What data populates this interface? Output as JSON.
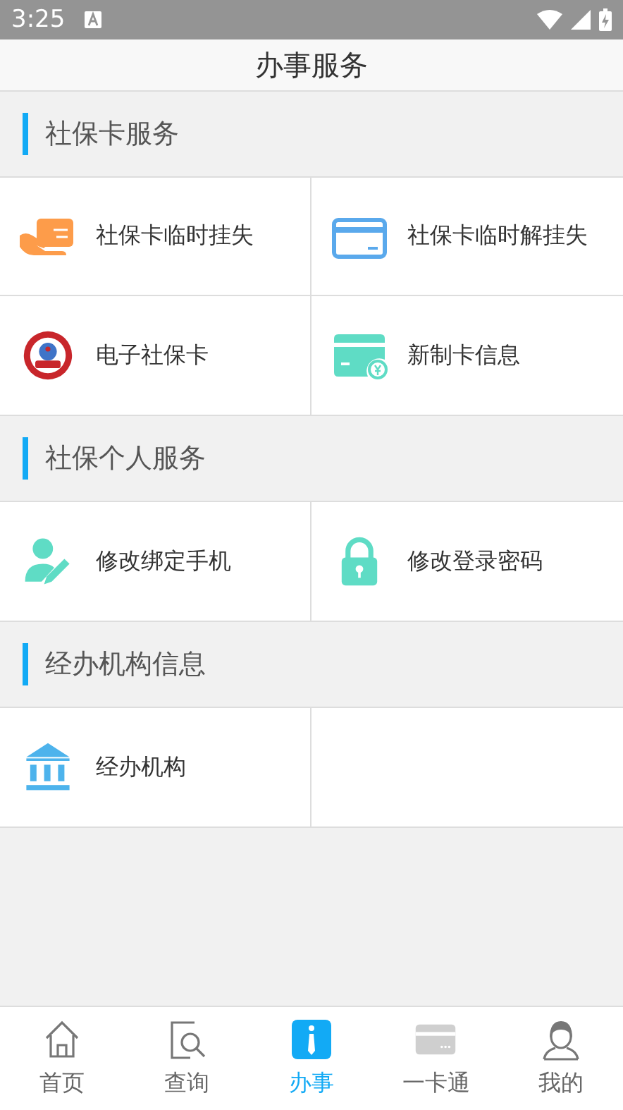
{
  "status_bar": {
    "time": "3:25"
  },
  "title": "办事服务",
  "sections": [
    {
      "title": "社保卡服务",
      "items": [
        {
          "label": "社保卡临时挂失",
          "kind": "handcard"
        },
        {
          "label": "社保卡临时解挂失",
          "kind": "card"
        },
        {
          "label": "电子社保卡",
          "kind": "seal"
        },
        {
          "label": "新制卡信息",
          "kind": "yuancard"
        }
      ]
    },
    {
      "title": "社保个人服务",
      "items": [
        {
          "label": "修改绑定手机",
          "kind": "useredit"
        },
        {
          "label": "修改登录密码",
          "kind": "lock"
        }
      ]
    },
    {
      "title": "经办机构信息",
      "items": [
        {
          "label": "经办机构",
          "kind": "bank"
        }
      ]
    }
  ],
  "nav": [
    {
      "label": "首页",
      "kind": "home",
      "selected": false
    },
    {
      "label": "查询",
      "kind": "search",
      "selected": false
    },
    {
      "label": "办事",
      "kind": "tie",
      "selected": true
    },
    {
      "label": "一卡通",
      "kind": "card",
      "selected": false
    },
    {
      "label": "我的",
      "kind": "user",
      "selected": false
    }
  ]
}
